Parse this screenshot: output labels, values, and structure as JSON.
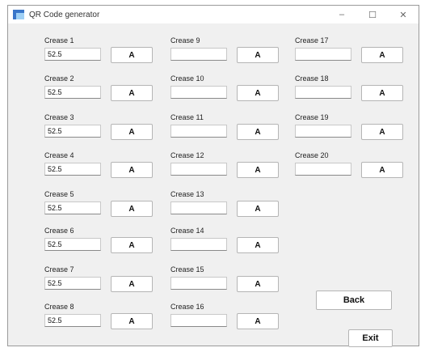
{
  "window": {
    "title": "QR Code generator",
    "minimize": "–",
    "maximize": "☐",
    "close": "✕"
  },
  "creases": [
    {
      "label": "Crease 1",
      "value": "52.5",
      "button": "A"
    },
    {
      "label": "Crease 2",
      "value": "52.5",
      "button": "A"
    },
    {
      "label": "Crease 3",
      "value": "52.5",
      "button": "A"
    },
    {
      "label": "Crease 4",
      "value": "52.5",
      "button": "A"
    },
    {
      "label": "Crease 5",
      "value": "52.5",
      "button": "A"
    },
    {
      "label": "Crease 6",
      "value": "52.5",
      "button": "A"
    },
    {
      "label": "Crease 7",
      "value": "52.5",
      "button": "A"
    },
    {
      "label": "Crease 8",
      "value": "52.5",
      "button": "A"
    },
    {
      "label": "Crease 9",
      "value": "",
      "button": "A"
    },
    {
      "label": "Crease 10",
      "value": "",
      "button": "A"
    },
    {
      "label": "Crease 11",
      "value": "",
      "button": "A"
    },
    {
      "label": "Crease 12",
      "value": "",
      "button": "A"
    },
    {
      "label": "Crease 13",
      "value": "",
      "button": "A"
    },
    {
      "label": "Crease 14",
      "value": "",
      "button": "A"
    },
    {
      "label": "Crease 15",
      "value": "",
      "button": "A"
    },
    {
      "label": "Crease 16",
      "value": "",
      "button": "A"
    },
    {
      "label": "Crease 17",
      "value": "",
      "button": "A"
    },
    {
      "label": "Crease 18",
      "value": "",
      "button": "A"
    },
    {
      "label": "Crease 19",
      "value": "",
      "button": "A"
    },
    {
      "label": "Crease 20",
      "value": "",
      "button": "A"
    }
  ],
  "actions": {
    "back": "Back",
    "exit": "Exit"
  }
}
